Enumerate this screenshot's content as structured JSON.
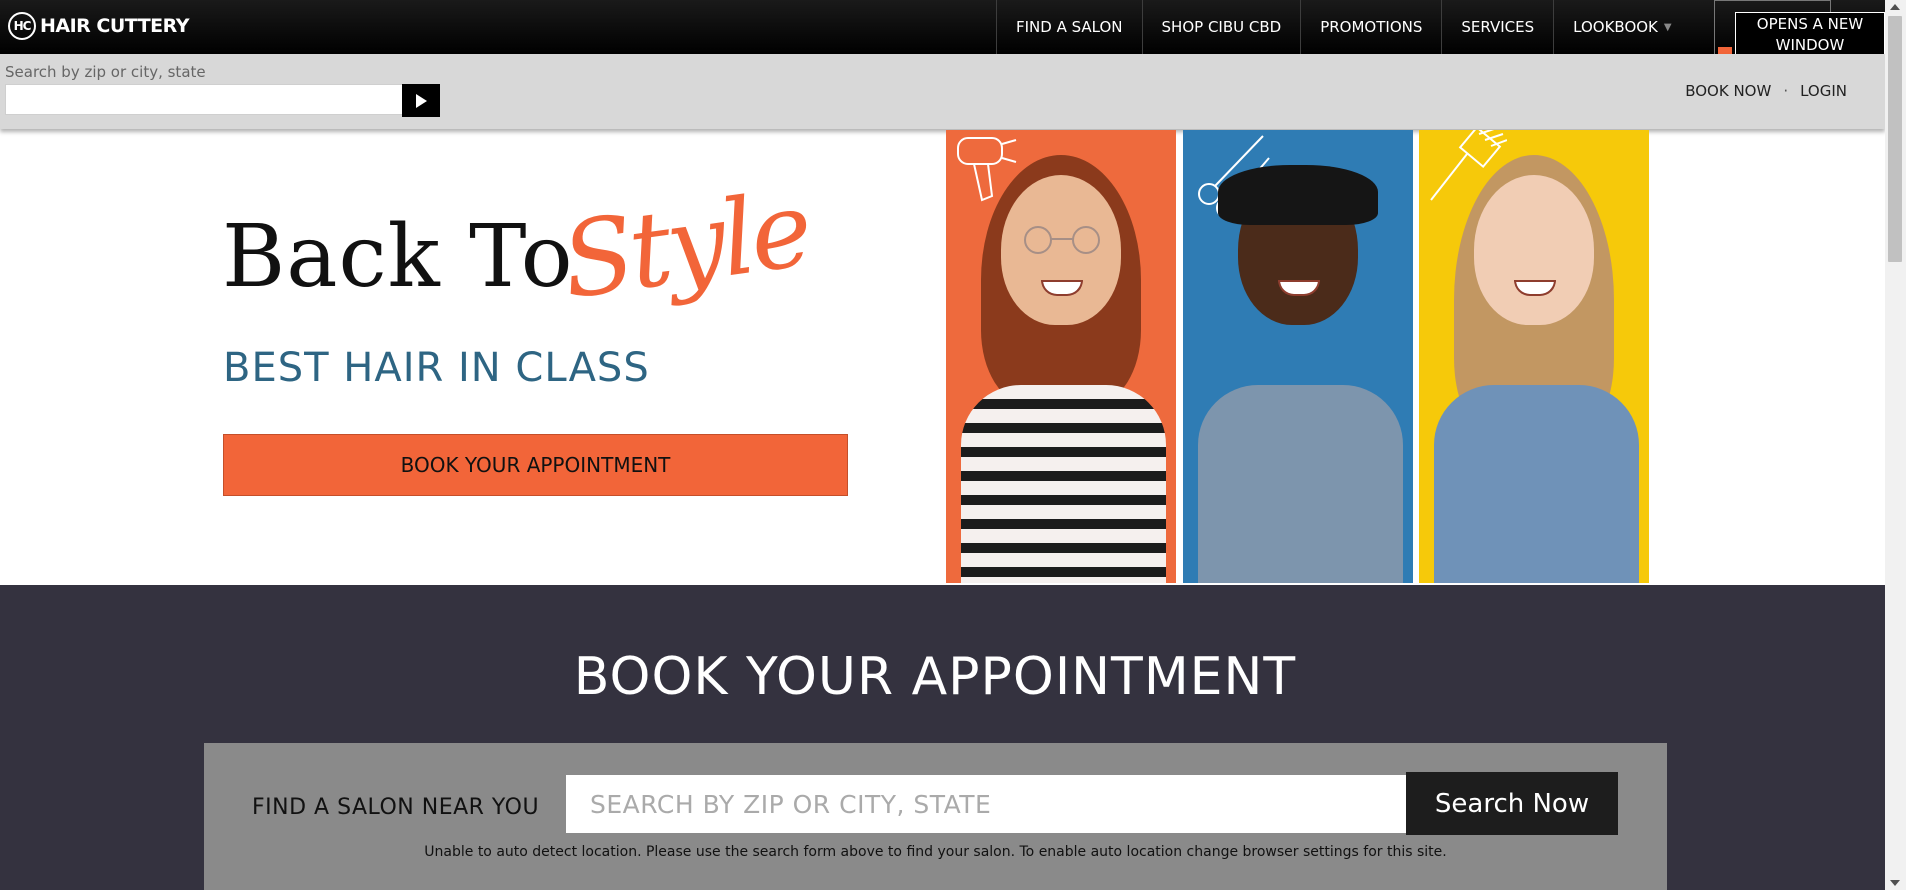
{
  "brand": {
    "logo_mark": "HC",
    "name": "HAIR CUTTERY"
  },
  "nav": {
    "items": [
      {
        "label": "FIND A SALON"
      },
      {
        "label": "SHOP CIBU CBD"
      },
      {
        "label": "PROMOTIONS"
      },
      {
        "label": "SERVICES"
      },
      {
        "label": "LOOKBOOK",
        "has_dropdown": true
      }
    ],
    "new_window_label": "OPENS A NEW WINDOW"
  },
  "subbar": {
    "search_label": "Search by zip or city, state",
    "search_value": "",
    "links": {
      "book_now": "BOOK NOW",
      "separator": "·",
      "login": "LOGIN"
    }
  },
  "hero": {
    "title": "Back To",
    "script_word": "Style",
    "subtitle": "BEST HAIR IN CLASS",
    "cta_label": "BOOK YOUR APPOINTMENT",
    "panel_colors": [
      "#ee6a3d",
      "#2f7cb4",
      "#f6c90a"
    ]
  },
  "booking": {
    "title": "BOOK YOUR APPOINTMENT",
    "finder_label": "FIND A SALON NEAR YOU",
    "input_placeholder": "SEARCH BY ZIP OR CITY, STATE",
    "search_button": "Search Now",
    "note": "Unable to auto detect location. Please use the search form above to find your salon. To enable auto location change browser settings for this site."
  },
  "colors": {
    "accent": "#f26539",
    "navy_text": "#2e6583",
    "section_bg": "#34323f",
    "finder_bg": "#8a8a8a"
  }
}
